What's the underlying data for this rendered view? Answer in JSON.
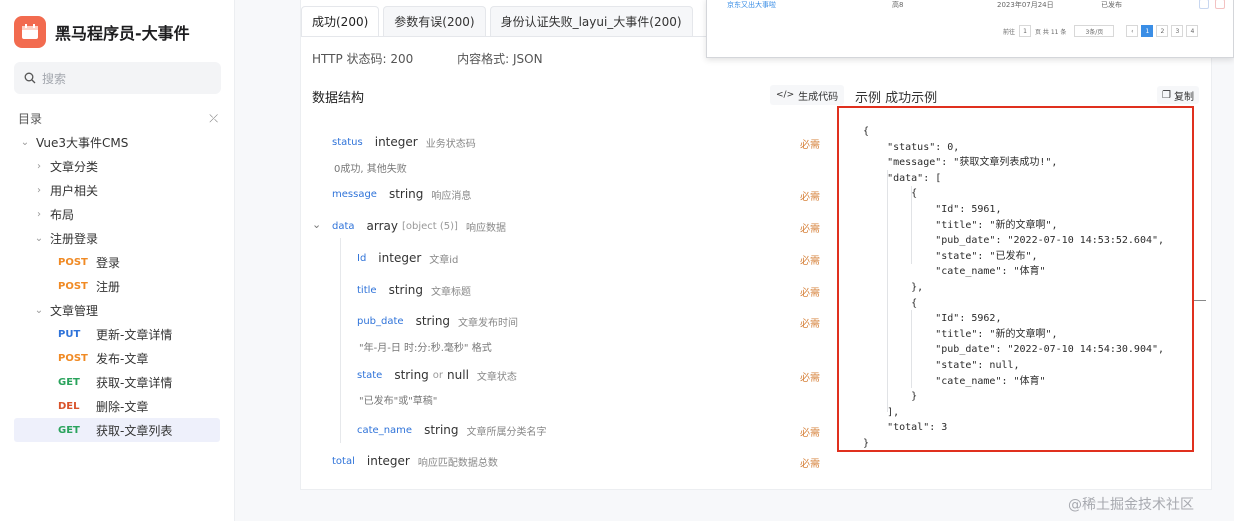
{
  "app": {
    "title": "黑马程序员-大事件",
    "accent": "#f26b4f"
  },
  "sidebar": {
    "search_placeholder": "搜索",
    "toc_label": "目录",
    "tree": [
      {
        "label": "Vue3大事件CMS",
        "level": 1,
        "arrow": "⌄"
      },
      {
        "label": "文章分类",
        "level": 2,
        "arrow": "›"
      },
      {
        "label": "用户相关",
        "level": 2,
        "arrow": "›"
      },
      {
        "label": "布局",
        "level": 2,
        "arrow": "›"
      },
      {
        "label": "注册登录",
        "level": 2,
        "arrow": "⌄"
      },
      {
        "method": "POST",
        "label": "登录",
        "level": 3
      },
      {
        "method": "POST",
        "label": "注册",
        "level": 3
      },
      {
        "label": "文章管理",
        "level": 2,
        "arrow": "⌄"
      },
      {
        "method": "PUT",
        "label": "更新-文章详情",
        "level": 3
      },
      {
        "method": "POST",
        "label": "发布-文章",
        "level": 3
      },
      {
        "method": "GET",
        "label": "获取-文章详情",
        "level": 3
      },
      {
        "method": "DEL",
        "label": "删除-文章",
        "level": 3
      },
      {
        "method": "GET",
        "label": "获取-文章列表",
        "level": 3,
        "active": true
      }
    ]
  },
  "tabs": [
    "成功(200)",
    "参数有误(200)",
    "身份认证失败_layui_大事件(200)"
  ],
  "meta": {
    "status_code": "HTTP 状态码: 200",
    "content_type": "内容格式: JSON"
  },
  "schema": {
    "title": "数据结构",
    "gen_code": "生成代码",
    "required": "必需",
    "fields": [
      {
        "name": "status",
        "type": "integer",
        "desc": "业务状态码",
        "note": "0成功, 其他失败"
      },
      {
        "name": "message",
        "type": "string",
        "desc": "响应消息"
      },
      {
        "name": "data",
        "type": "array",
        "extra": "[object (5)]",
        "desc": "响应数据"
      },
      {
        "name": "Id",
        "type": "integer",
        "desc": "文章id"
      },
      {
        "name": "title",
        "type": "string",
        "desc": "文章标题"
      },
      {
        "name": "pub_date",
        "type": "string",
        "desc": "文章发布时间",
        "note": "\"年-月-日 时:分:秒.毫秒\" 格式"
      },
      {
        "name": "state",
        "type": "string",
        "or": "or",
        "type2": "null",
        "desc": "文章状态",
        "note": "\"已发布\"或\"草稿\""
      },
      {
        "name": "cate_name",
        "type": "string",
        "desc": "文章所属分类名字"
      },
      {
        "name": "total",
        "type": "integer",
        "desc": "响应匹配数据总数"
      }
    ]
  },
  "example": {
    "title": "示例  成功示例",
    "copy": "复制",
    "lines": [
      "{",
      "    \"status\": 0,",
      "    \"message\": \"获取文章列表成功!\",",
      "    \"data\": [",
      "        {",
      "            \"Id\": 5961,",
      "            \"title\": \"新的文章啊\",",
      "            \"pub_date\": \"2022-07-10 14:53:52.604\",",
      "            \"state\": \"已发布\",",
      "            \"cate_name\": \"体育\"",
      "        },",
      "        {",
      "            \"Id\": 5962,",
      "            \"title\": \"新的文章啊\",",
      "            \"pub_date\": \"2022-07-10 14:54:30.904\",",
      "            \"state\": null,",
      "            \"cate_name\": \"体育\"",
      "        }",
      "    ],",
      "    \"total\": 3",
      "}"
    ]
  },
  "popup": {
    "row_title": "京东又出大事啦",
    "row_cat": "高8",
    "row_date": "2023年07月24日",
    "row_state": "已发布",
    "pager_prefix": "前往",
    "pager_page": "1",
    "pager_suffix": "页 共 11 条",
    "pager_size": "3条/页",
    "pages": [
      "1",
      "2",
      "3",
      "4"
    ]
  },
  "watermark": "@稀土掘金技术社区"
}
